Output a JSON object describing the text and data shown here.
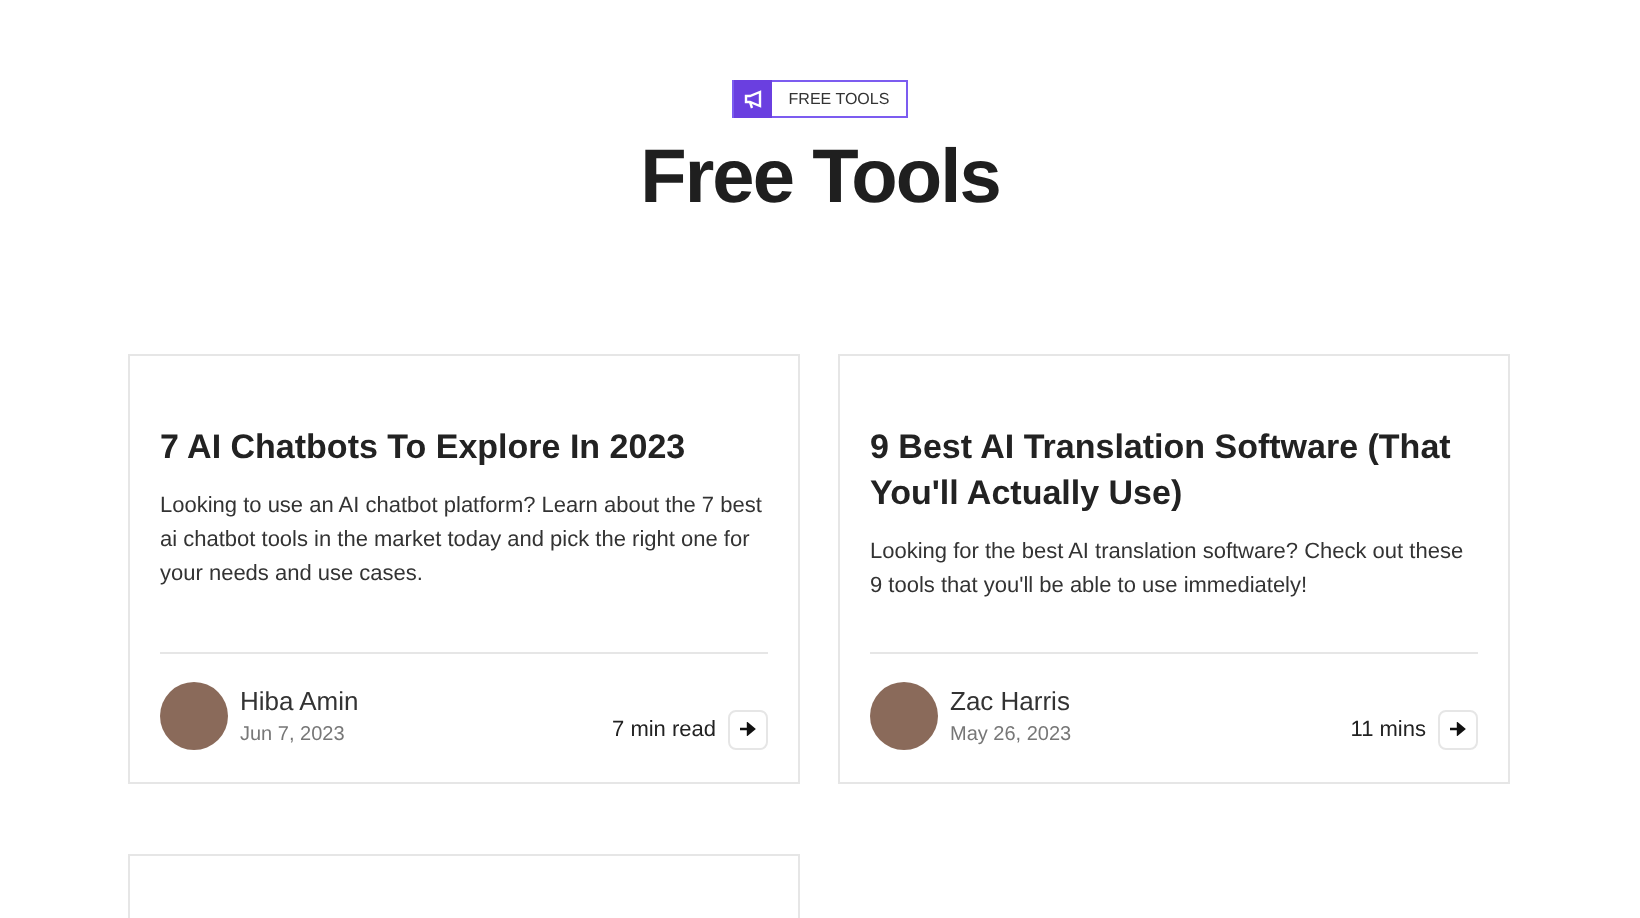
{
  "badge": {
    "label": "FREE TOOLS"
  },
  "heading": "Free Tools",
  "articles": [
    {
      "title": "7 AI Chatbots To Explore In 2023",
      "excerpt": "Looking to use an AI chatbot platform? Learn about the 7 best ai chatbot tools in the market today and pick the right one for your needs and use cases.",
      "author": "Hiba Amin",
      "date": "Jun 7, 2023",
      "read_time": "7 min read"
    },
    {
      "title": "9 Best AI Translation Software (That You'll Actually Use)",
      "excerpt": "Looking for the best AI translation software? Check out these 9 tools that you'll be able to use immediately!",
      "author": "Zac Harris",
      "date": "May 26, 2023",
      "read_time": "11 mins"
    }
  ]
}
